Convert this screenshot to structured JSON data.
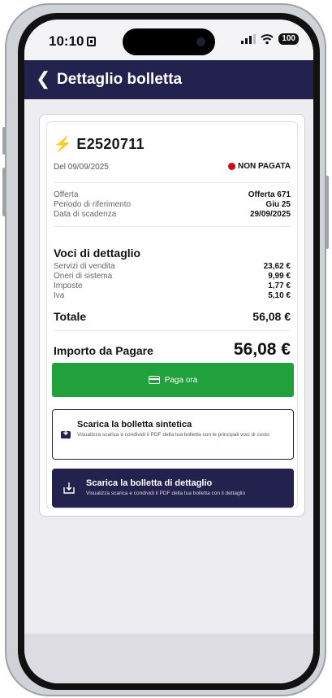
{
  "status_bar": {
    "time": "10:10",
    "battery": "100"
  },
  "header": {
    "title": "Dettaglio bolletta"
  },
  "bill": {
    "id": "E2520711",
    "date": "Del 09/09/2025",
    "status": "NON PAGATA",
    "status_color": "#d0021b",
    "info": [
      {
        "label": "Offerta",
        "value": "Offerta 671"
      },
      {
        "label": "Periodo di riferimento",
        "value": "Giu 25"
      },
      {
        "label": "Data di scadenza",
        "value": "29/09/2025"
      }
    ],
    "details_title": "Voci di dettaglio",
    "details": [
      {
        "label": "Servizi di vendita",
        "value": "23,62 €"
      },
      {
        "label": "Oneri di sistema",
        "value": "9,99 €"
      },
      {
        "label": "Imposte",
        "value": "1,77 €"
      },
      {
        "label": "Iva",
        "value": "5,10 €"
      }
    ],
    "total_label": "Totale",
    "total_value": "56,08 €",
    "amount_label": "Importo da Pagare",
    "amount_value": "56,08 €"
  },
  "actions": {
    "pay_label": "Paga ora",
    "pay_color": "#21a13c",
    "download_summary_title": "Scarica la bolletta sintetica",
    "download_summary_desc": "Visualizza scarica e condividi il PDF della tua bolletta con le principali voci di costo",
    "download_detail_title": "Scarica la bolletta di dettaglio",
    "download_detail_desc": "Visualizza scarica e condividi il PDF della tua bolletta con il dettaglio"
  },
  "icons": {
    "back": "chevron-left-icon",
    "bill": "lightning-bolt-icon",
    "pay": "credit-card-icon",
    "download_summary": "download-icon",
    "download_detail": "download-icon"
  },
  "colors": {
    "header": "#23224f",
    "bolt": "#f5a623"
  }
}
